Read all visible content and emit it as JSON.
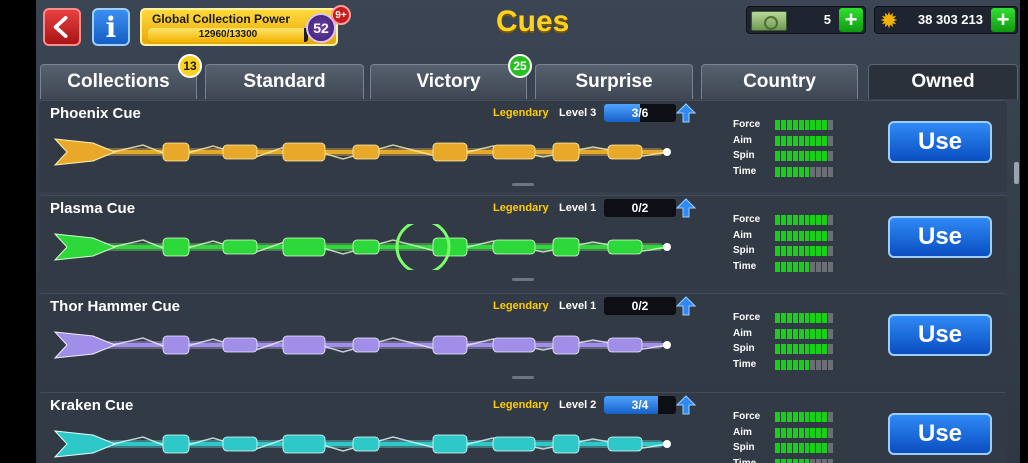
{
  "header": {
    "title": "Cues",
    "collection_power": {
      "label": "Global Collection Power",
      "value_text": "12960/13300",
      "progress": 0.974,
      "level": "52",
      "badge": "9+"
    },
    "cash": {
      "value": "5",
      "icon": "cash-icon"
    },
    "coins": {
      "value": "38 303 213",
      "icon": "coin-icon"
    }
  },
  "tabs": [
    {
      "label": "Collections",
      "badge": "13"
    },
    {
      "label": "Standard",
      "badge": ""
    },
    {
      "label": "Victory",
      "badge": "25"
    },
    {
      "label": "Surprise",
      "badge": ""
    },
    {
      "label": "Country",
      "badge": ""
    },
    {
      "label": "Owned",
      "badge": "",
      "active": true
    }
  ],
  "stat_labels": [
    "Force",
    "Aim",
    "Spin",
    "Time"
  ],
  "use_label": "Use",
  "cues": [
    {
      "name": "Phoenix Cue",
      "rarity": "Legendary",
      "level": "Level 3",
      "progress_text": "3/6",
      "progress": 0.5,
      "stats": [
        9,
        9,
        9,
        6
      ],
      "colors": {
        "main": "#e8a92a",
        "glow": "#ffcf5a",
        "accent": "#fff0b0"
      }
    },
    {
      "name": "Plasma Cue",
      "rarity": "Legendary",
      "level": "Level 1",
      "progress_text": "0/2",
      "progress": 0,
      "stats": [
        9,
        9,
        9,
        6
      ],
      "colors": {
        "main": "#2cd83a",
        "glow": "#7dff6a",
        "accent": "#d8ffd0"
      }
    },
    {
      "name": "Thor Hammer Cue",
      "rarity": "Legendary",
      "level": "Level 1",
      "progress_text": "0/2",
      "progress": 0,
      "stats": [
        9,
        9,
        9,
        6
      ],
      "colors": {
        "main": "#a08ee8",
        "glow": "#c9b8ff",
        "accent": "#f0ecff"
      }
    },
    {
      "name": "Kraken Cue",
      "rarity": "Legendary",
      "level": "Level 2",
      "progress_text": "3/4",
      "progress": 0.75,
      "stats": [
        9,
        9,
        9,
        6
      ],
      "colors": {
        "main": "#2fc8c8",
        "glow": "#62f0e8",
        "accent": "#e0fffa"
      }
    }
  ]
}
